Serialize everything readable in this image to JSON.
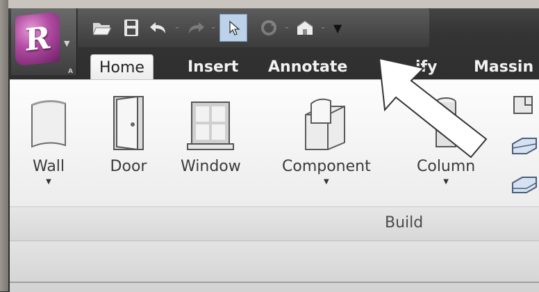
{
  "app": {
    "logo_letter": "R",
    "badge": "A"
  },
  "quick_access": {
    "icons": [
      "open-folder-icon",
      "save-icon",
      "undo-icon",
      "redo-icon",
      "modify-select-icon",
      "sync-icon",
      "default-3d-view-icon",
      "dropdown-icon"
    ]
  },
  "tabs": {
    "home": "Home",
    "insert": "Insert",
    "annotate": "Annotate",
    "modify_partial": "ify",
    "massing": "Massin"
  },
  "ribbon": {
    "tools": {
      "wall": "Wall",
      "door": "Door",
      "window": "Window",
      "component": "Component",
      "column": "Column"
    },
    "panel_label": "Build"
  },
  "colors": {
    "accent_selected": "#bcd2ea",
    "app_logo": "#b24da3"
  }
}
